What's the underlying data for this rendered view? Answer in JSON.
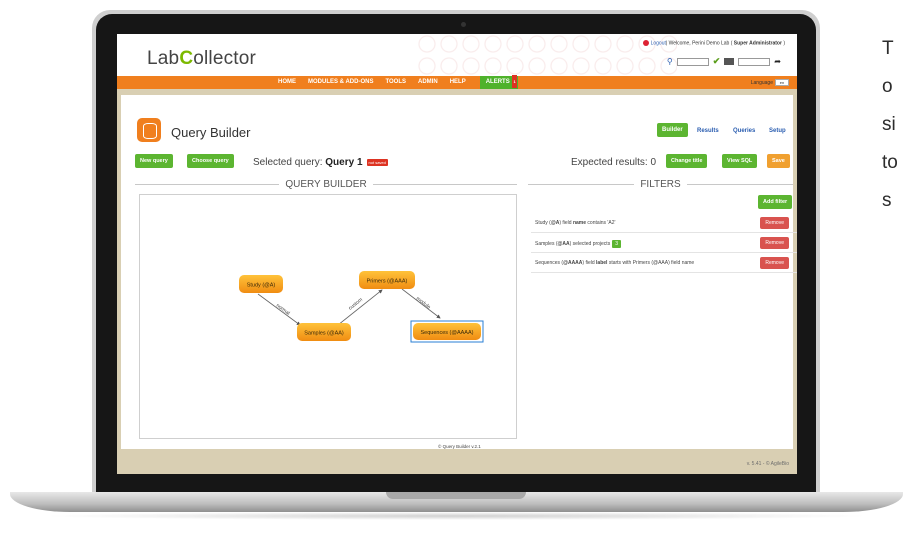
{
  "app": {
    "logo": {
      "part1": "Lab",
      "part2": "C",
      "part3": "ollector"
    },
    "topbar": {
      "logout": "Logout",
      "welcome": "| Welcome, Perini Demo Lab ( ",
      "role": "Super Administrator",
      "close": " )"
    },
    "nav": [
      "HOME",
      "MODULES & ADD-ONS",
      "TOOLS",
      "ADMIN",
      "HELP"
    ],
    "alerts": {
      "label": "ALERTS",
      "count": "1"
    },
    "language": {
      "label": "Language",
      "value": "en"
    }
  },
  "module": {
    "title": "Query Builder",
    "tabs": {
      "builder": "Builder",
      "results": "Results",
      "queries": "Queries",
      "setup": "Setup"
    }
  },
  "toolbar": {
    "new_query": "New query",
    "choose_query": "Choose query",
    "selected_prefix": "Selected query: ",
    "selected_name": "Query 1",
    "not_saved": "not saved",
    "expected": "Expected results: 0",
    "change_title": "Change title",
    "view_sql": "View SQL",
    "save": "Save"
  },
  "builder": {
    "heading": "QUERY BUILDER",
    "nodes": [
      {
        "label": "Study (@A)",
        "selected": false
      },
      {
        "label": "Samples (@AA)",
        "selected": false
      },
      {
        "label": "Primers (@AAA)",
        "selected": false
      },
      {
        "label": "Sequences (@AAAA)",
        "selected": true
      }
    ],
    "edges": [
      "normal",
      "custom",
      "module"
    ],
    "credit": "© Query Builder v.2.1",
    "node_color": "#f7a21b",
    "selection_color": "#2a7fd4"
  },
  "filters": {
    "heading": "FILTERS",
    "add_filter": "Add filter",
    "remove_label": "Remove",
    "rows": [
      {
        "pre": "Study (",
        "alias": "@A",
        "mid": ") field ",
        "field": "name",
        "post": " contains 'A2'"
      },
      {
        "pre": "Samples (",
        "alias": "@AA",
        "mid": ") selected projects",
        "field": "",
        "post": "",
        "count": "3"
      },
      {
        "pre": "Sequences (",
        "alias": "@AAAA",
        "mid": ") field ",
        "field": "label",
        "post": " starts with Primers (@AAA) field name"
      }
    ]
  },
  "footer": {
    "version": "v. 5.41 - © AgileBio"
  },
  "side_text": [
    "T",
    "o",
    "si",
    "to",
    "s"
  ],
  "colors": {
    "orange": "#f07f1e",
    "green": "#5cb531",
    "red": "#d9534f",
    "beige": "#d9cfb3"
  }
}
